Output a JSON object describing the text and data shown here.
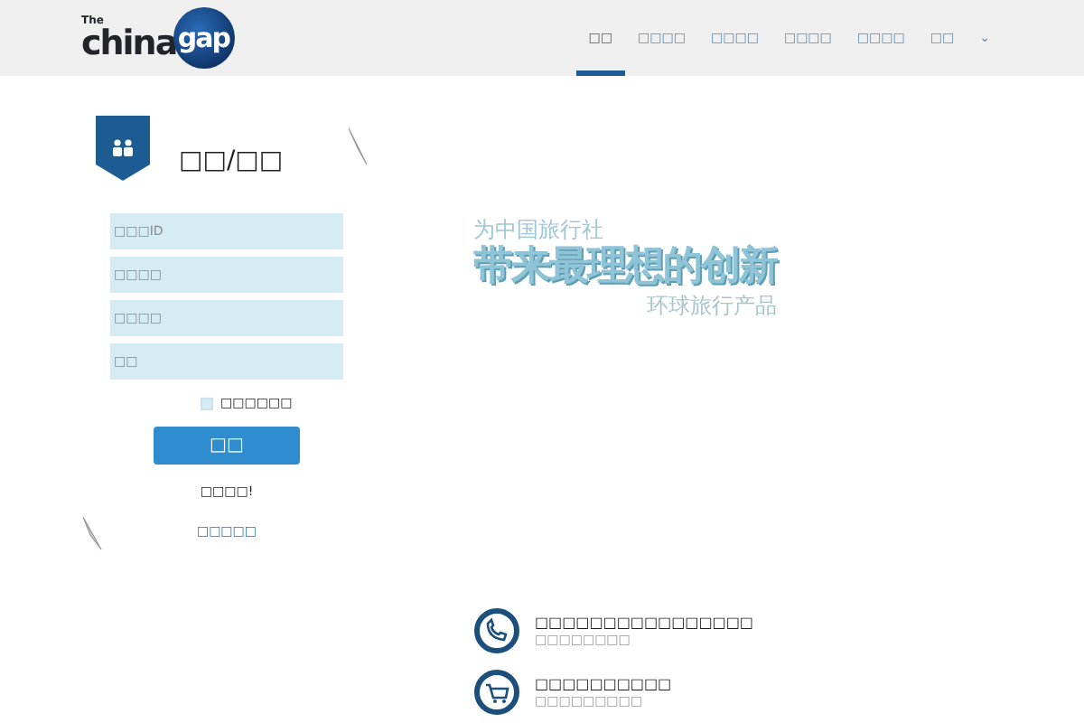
{
  "logo": {
    "small": "The",
    "main": "china",
    "circle": "gap"
  },
  "nav": [
    {
      "label": "□□",
      "selected": true
    },
    {
      "label": "□□□□",
      "selected": false
    },
    {
      "label": "□□□□",
      "selected": false
    },
    {
      "label": "□□□□",
      "selected": false
    },
    {
      "label": "□□□□",
      "selected": false
    },
    {
      "label": "□□",
      "selected": false
    },
    {
      "label": "⌄",
      "selected": false
    }
  ],
  "login": {
    "title": "□□/□□",
    "fields": [
      {
        "placeholder": "□□□ID"
      },
      {
        "placeholder": "□□□□"
      },
      {
        "placeholder": "□□□□"
      },
      {
        "placeholder": "□□"
      }
    ],
    "remember": {
      "label": "□□□□□□",
      "checked": false
    },
    "button": "□□",
    "forgot": "□□□□!",
    "register": "□□□□□"
  },
  "hero": {
    "line1": "为中国旅行社",
    "line2": "带来最理想的创新",
    "line3": "环球旅行产品"
  },
  "features": [
    {
      "kind": "phone",
      "title": "□□□□□□□□□□□□□□□□",
      "subtitle": "□□□□□□□□"
    },
    {
      "kind": "cart",
      "title": "□□□□□□□□□□",
      "subtitle": "□□□□□□□□□"
    }
  ]
}
